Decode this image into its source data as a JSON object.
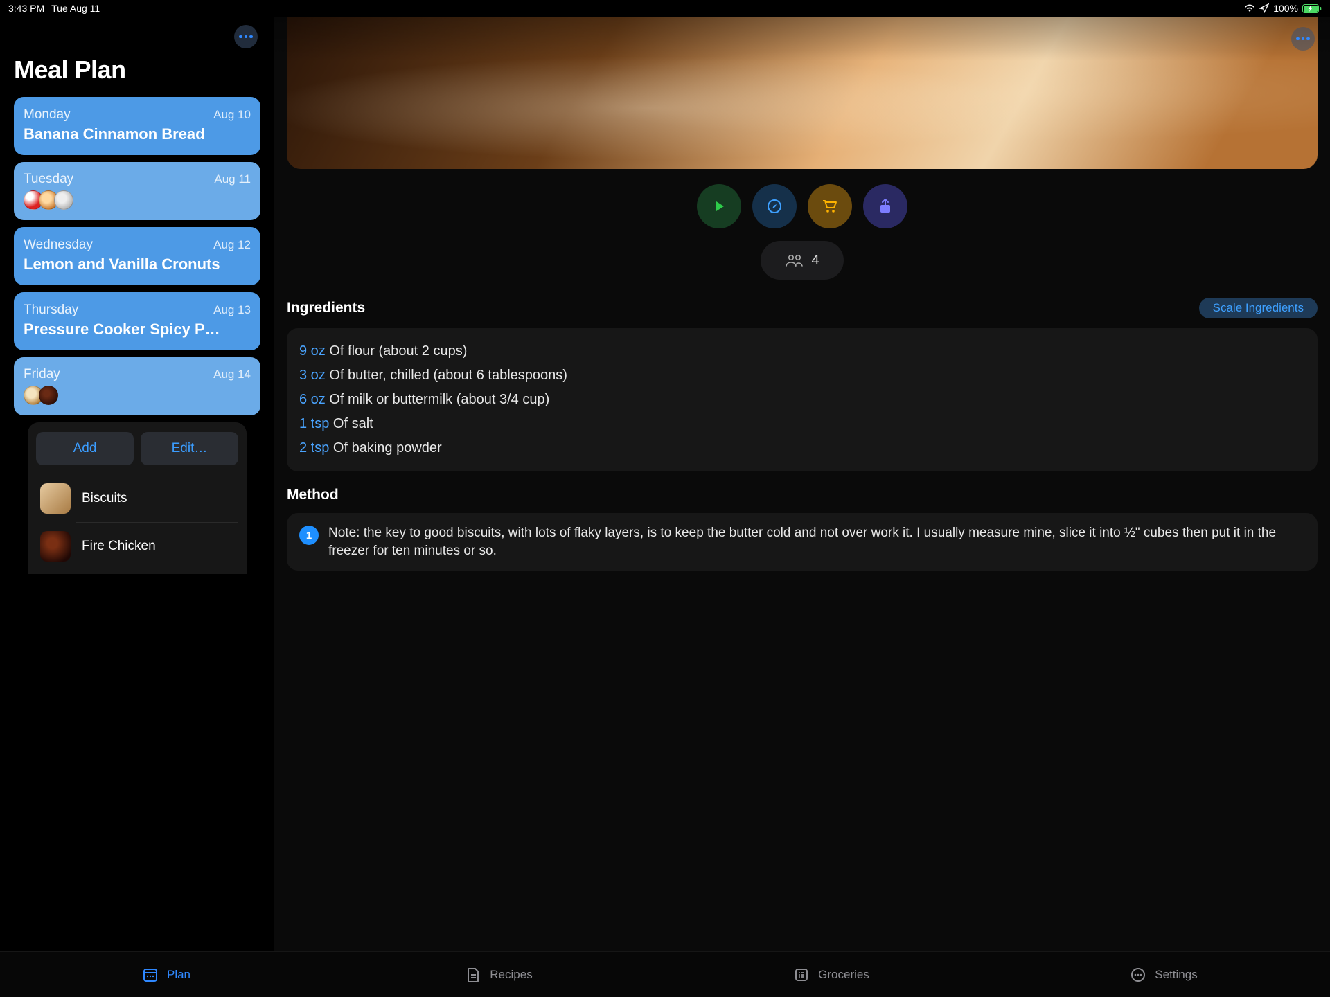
{
  "status": {
    "time": "3:43 PM",
    "date": "Tue Aug 11",
    "battery": "100%"
  },
  "sidebar": {
    "title": "Meal Plan",
    "days": [
      {
        "day": "Monday",
        "date": "Aug 10",
        "recipe": "Banana Cinnamon Bread"
      },
      {
        "day": "Tuesday",
        "date": "Aug 11"
      },
      {
        "day": "Wednesday",
        "date": "Aug 12",
        "recipe": "Lemon and Vanilla Cronuts"
      },
      {
        "day": "Thursday",
        "date": "Aug 13",
        "recipe": "Pressure Cooker Spicy P…"
      },
      {
        "day": "Friday",
        "date": "Aug 14"
      }
    ],
    "add": "Add",
    "edit": "Edit…",
    "clipboard": [
      {
        "name": "Biscuits"
      },
      {
        "name": "Fire Chicken"
      }
    ]
  },
  "detail": {
    "servings": "4",
    "ingredients_title": "Ingredients",
    "scale_label": "Scale Ingredients",
    "ingredients": [
      {
        "qty": "9 oz",
        "text": "Of flour (about 2 cups)"
      },
      {
        "qty": "3 oz",
        "text": "Of butter, chilled (about 6 tablespoons)"
      },
      {
        "qty": "6 oz",
        "text": "Of milk or buttermilk (about  3/4 cup)"
      },
      {
        "qty": "1 tsp",
        "text": "Of salt"
      },
      {
        "qty": "2 tsp",
        "text": "Of baking powder"
      }
    ],
    "method_title": "Method",
    "steps": [
      {
        "n": "1",
        "text": "Note: the key to good biscuits, with lots of flaky layers, is to keep the butter cold and not over work it. I usually measure mine, slice it into ½\" cubes then put it in the freezer for ten minutes or so."
      }
    ]
  },
  "tabs": {
    "plan": "Plan",
    "recipes": "Recipes",
    "groceries": "Groceries",
    "settings": "Settings"
  }
}
